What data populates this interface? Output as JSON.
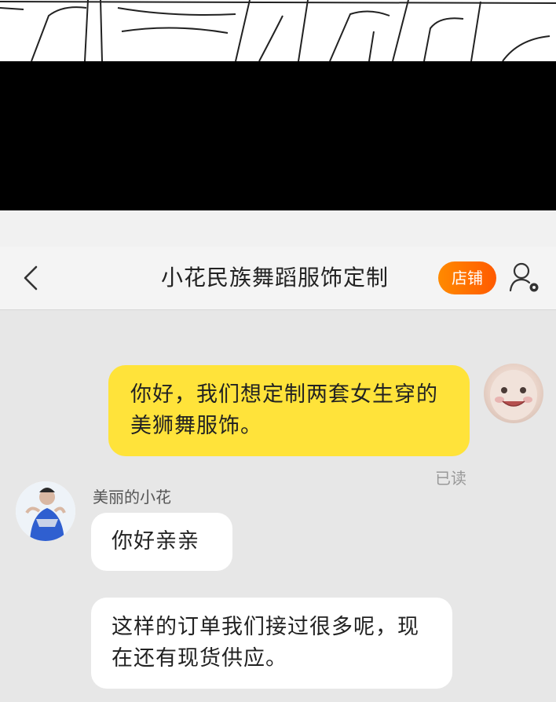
{
  "header": {
    "title": "小花民族舞蹈服饰定制",
    "store_label": "店铺",
    "back_icon": "chevron-left-icon",
    "profile_icon": "user-settings-icon"
  },
  "messages": [
    {
      "direction": "outgoing",
      "text": "你好，我们想定制两套女生穿的美狮舞服饰。",
      "status": "已读"
    },
    {
      "direction": "incoming",
      "sender": "美丽的小花",
      "text": "你好亲亲"
    },
    {
      "direction": "incoming",
      "sender": "美丽的小花",
      "text": "这样的订单我们接过很多呢，现在还有现货供应。"
    }
  ],
  "colors": {
    "outgoing_bubble": "#ffe33a",
    "incoming_bubble": "#ffffff",
    "store_button": "#ff6d00",
    "blackout": "#000000"
  }
}
